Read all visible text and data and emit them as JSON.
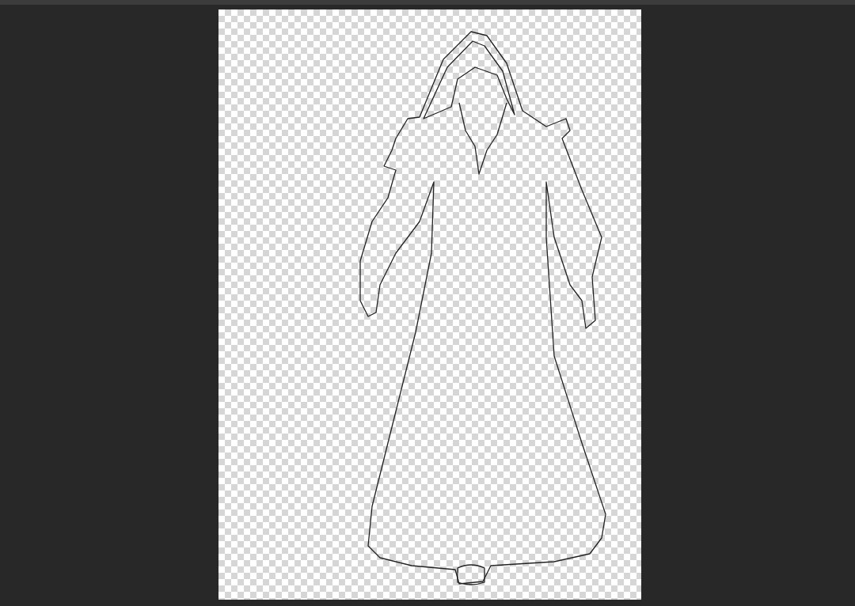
{
  "canvas": {
    "transparent": true
  }
}
